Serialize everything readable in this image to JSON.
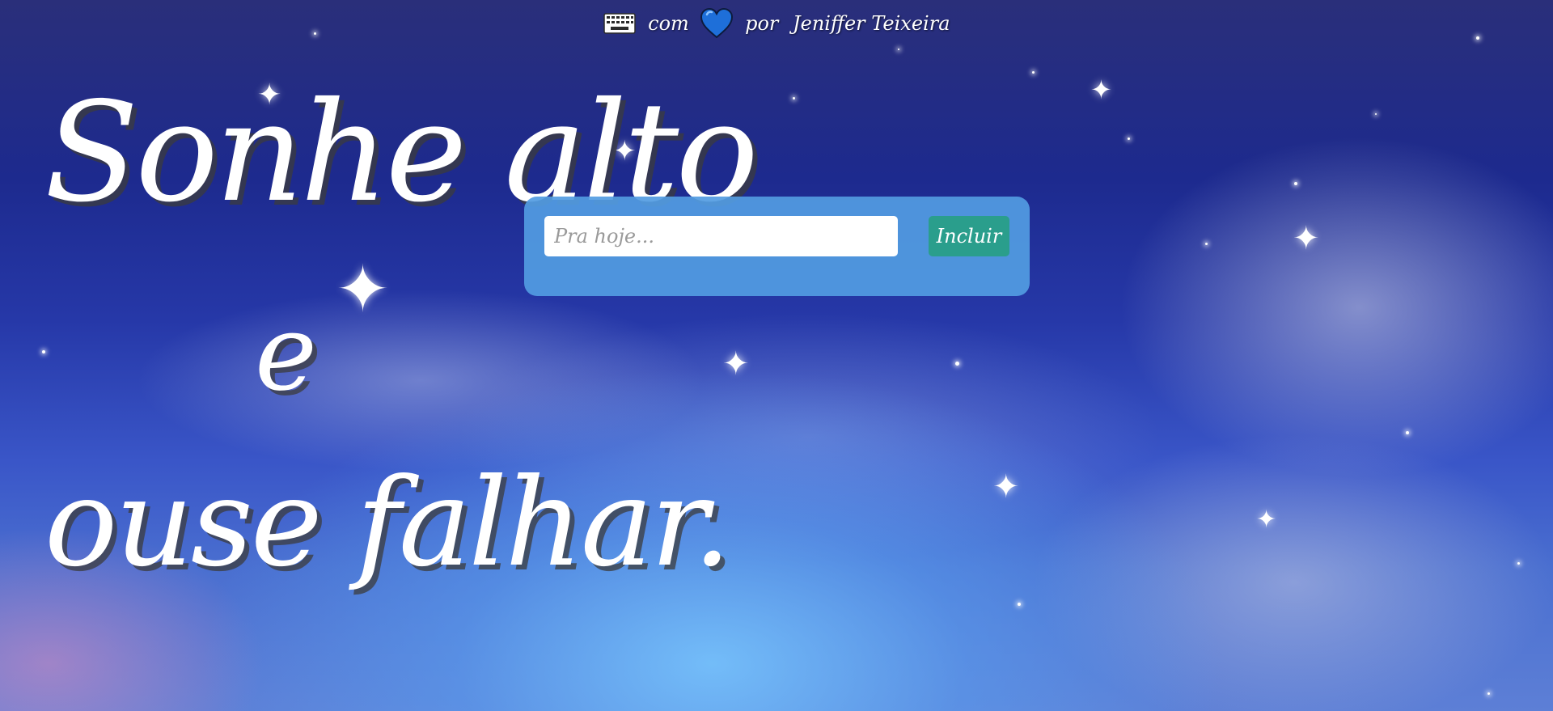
{
  "header": {
    "keyboard_icon": "keyboard-icon",
    "with_text": "com",
    "heart_icon": "blue-heart-icon",
    "by_text": "por",
    "author": "Jeniffer Teixeira"
  },
  "quote": {
    "line1": "Sonhe alto",
    "line2": "e",
    "line3": "ouse falhar."
  },
  "todo": {
    "input_placeholder": "Pra hoje...",
    "input_value": "",
    "add_button_label": "Incluir"
  },
  "colors": {
    "panel": "#529CE2",
    "button": "#2A9E8C",
    "heart": "#1E6FD9",
    "text": "#FFFFFF"
  }
}
